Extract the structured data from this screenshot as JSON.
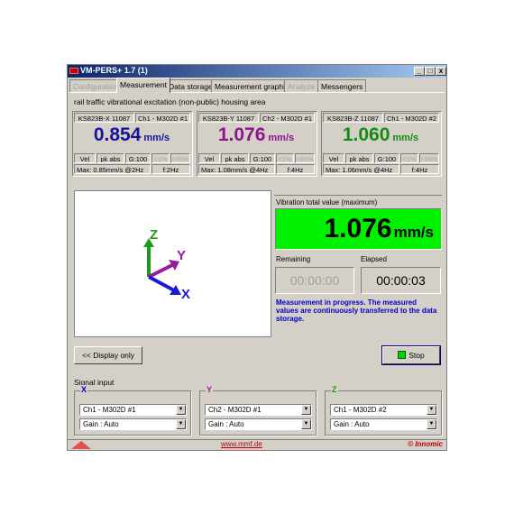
{
  "window": {
    "title": "VM-PERS+ 1.7 (1)",
    "min_label": "_",
    "max_label": "□",
    "close_label": "x"
  },
  "tabs": [
    {
      "label": "Configuration",
      "state": "disabled"
    },
    {
      "label": "Measurement",
      "state": "active"
    },
    {
      "label": "Data storage",
      "state": "normal"
    },
    {
      "label": "Measurement graphic",
      "state": "normal"
    },
    {
      "label": "Analyze",
      "state": "disabled"
    },
    {
      "label": "Messengers",
      "state": "normal"
    }
  ],
  "description": "rail traffic vibrational excitation (non-public) housing area",
  "channels": [
    {
      "sensor": "KS823B-X 11087",
      "channel": "Ch1 - M302D #1",
      "value": "0.854",
      "unit": "mm/s",
      "color": "#141496",
      "mode": "Vel",
      "peak": "pk abs",
      "gain": "G:100",
      "lt1": "<1%",
      "gt95": ">95%",
      "max": "Max: 0.85mm/s @2Hz",
      "freq": "f:2Hz"
    },
    {
      "sensor": "KS823B-Y 11087",
      "channel": "Ch2 - M302D #1",
      "value": "1.076",
      "unit": "mm/s",
      "color": "#8c1490",
      "mode": "Vel",
      "peak": "pk abs",
      "gain": "G:100",
      "lt1": "<1%",
      "gt95": ">95%",
      "max": "Max: 1.08mm/s @4Hz",
      "freq": "f:4Hz"
    },
    {
      "sensor": "KS823B-Z 11087",
      "channel": "Ch1 - M302D #2",
      "value": "1.060",
      "unit": "mm/s",
      "color": "#148c14",
      "mode": "Vel",
      "peak": "pk abs",
      "gain": "G:100",
      "lt1": "<1%",
      "gt95": ">95%",
      "max": "Max: 1.06mm/s @4Hz",
      "freq": "f:4Hz"
    }
  ],
  "axes": {
    "x": "X",
    "y": "Y",
    "z": "Z",
    "x_color": "#1a1ad2",
    "y_color": "#9a1a9a",
    "z_color": "#1a9a1a"
  },
  "total": {
    "label": "Vibration total value (maximum)",
    "value": "1.076",
    "unit": "mm/s",
    "bg_color": "#00f000"
  },
  "timers": {
    "remaining_label": "Remaining",
    "remaining": "00:00:00",
    "elapsed_label": "Elapsed",
    "elapsed": "00:00:03"
  },
  "status_message": "Measurement in progress. The measured values are continuously transferred to the data storage.",
  "buttons": {
    "display_only": "<< Display only",
    "stop": "Stop"
  },
  "signal_input": {
    "label": "Signal input",
    "groups": [
      {
        "axis": "X",
        "channel": "Ch1 - M302D #1",
        "gain": "Gain : Auto"
      },
      {
        "axis": "Y",
        "channel": "Ch2 - M302D #1",
        "gain": "Gain : Auto"
      },
      {
        "axis": "Z",
        "channel": "Ch1 - M302D #2",
        "gain": "Gain : Auto"
      }
    ]
  },
  "footer": {
    "url": "www.mmf.de",
    "brand": "© Innomic"
  }
}
